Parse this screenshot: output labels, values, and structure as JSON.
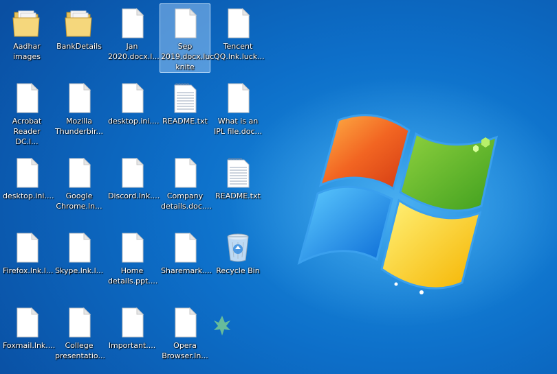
{
  "desktop_icons": [
    {
      "name": "icon-aadhar-images",
      "label": "Aadhar\nimages",
      "type": "folder",
      "col": 0,
      "row": 0
    },
    {
      "name": "icon-bankdetails",
      "label": "BankDetails",
      "type": "folder",
      "col": 1,
      "row": 0
    },
    {
      "name": "icon-jan-2020",
      "label": "Jan\n2020.docx.l...",
      "type": "file",
      "col": 2,
      "row": 0
    },
    {
      "name": "icon-sep-2019",
      "label": "Sep\n2019.docx.luc\nknite",
      "type": "file",
      "col": 3,
      "row": 0,
      "selected": true
    },
    {
      "name": "icon-tencent-qq",
      "label": "Tencent\nQQ.lnk.luck...",
      "type": "file",
      "col": 4,
      "row": 0
    },
    {
      "name": "icon-acrobat-reader",
      "label": "Acrobat\nReader DC.l...",
      "type": "file",
      "col": 0,
      "row": 1
    },
    {
      "name": "icon-mozilla-thunderbird",
      "label": "Mozilla\nThunderbir...",
      "type": "file",
      "col": 1,
      "row": 1
    },
    {
      "name": "icon-desktop-ini-1",
      "label": "desktop.ini....",
      "type": "file",
      "col": 2,
      "row": 1
    },
    {
      "name": "icon-readme-txt-1",
      "label": "README.txt",
      "type": "text",
      "col": 3,
      "row": 1
    },
    {
      "name": "icon-ipl-file",
      "label": "What is an\nIPL file.doc...",
      "type": "file",
      "col": 4,
      "row": 1
    },
    {
      "name": "icon-desktop-ini-2",
      "label": "desktop.ini....",
      "type": "file",
      "col": 0,
      "row": 2
    },
    {
      "name": "icon-google-chrome",
      "label": "Google\nChrome.ln...",
      "type": "file",
      "col": 1,
      "row": 2
    },
    {
      "name": "icon-discord",
      "label": "Discord.lnk....",
      "type": "file",
      "col": 2,
      "row": 2
    },
    {
      "name": "icon-company-details",
      "label": "Company\ndetails.doc....",
      "type": "file",
      "col": 3,
      "row": 2
    },
    {
      "name": "icon-readme-txt-2",
      "label": "README.txt",
      "type": "text",
      "col": 4,
      "row": 2
    },
    {
      "name": "icon-firefox",
      "label": "Firefox.lnk.l...",
      "type": "file",
      "col": 0,
      "row": 3
    },
    {
      "name": "icon-skype",
      "label": "Skype.lnk.l...",
      "type": "file",
      "col": 1,
      "row": 3
    },
    {
      "name": "icon-home-details",
      "label": "Home\ndetails.ppt....",
      "type": "file",
      "col": 2,
      "row": 3
    },
    {
      "name": "icon-sharemark",
      "label": "Sharemark....",
      "type": "file",
      "col": 3,
      "row": 3
    },
    {
      "name": "icon-recycle-bin",
      "label": "Recycle Bin",
      "type": "recycle",
      "col": 4,
      "row": 3
    },
    {
      "name": "icon-foxmail",
      "label": "Foxmail.lnk....",
      "type": "file",
      "col": 0,
      "row": 4
    },
    {
      "name": "icon-college-presentation",
      "label": "College\npresentatio...",
      "type": "file",
      "col": 1,
      "row": 4
    },
    {
      "name": "icon-important",
      "label": "Important....",
      "type": "file",
      "col": 2,
      "row": 4
    },
    {
      "name": "icon-opera-browser",
      "label": "Opera\nBrowser.ln...",
      "type": "file",
      "col": 3,
      "row": 4
    }
  ]
}
